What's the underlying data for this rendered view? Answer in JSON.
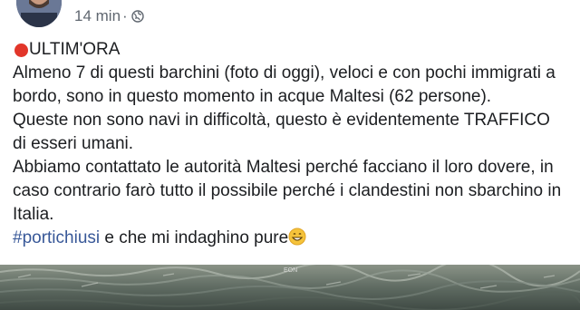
{
  "header": {
    "time": "14 min",
    "separator": "·",
    "privacy_icon": "globe-icon"
  },
  "post": {
    "flag_icon": "red-circle-icon",
    "title": "ULTIM'ORA",
    "lines": [
      "Almeno 7 di questi barchini (foto di oggi), veloci e con pochi immigrati a",
      "bordo, sono in questo momento in acque Maltesi (62 persone).",
      "Queste non sono navi in difficoltà, questo è evidentemente TRAFFICO",
      "di esseri umani.",
      "Abbiamo contattato le autorità Maltesi perché facciano il loro dovere, in",
      "caso contrario farò tutto il possibile perché i clandestini non sbarchino in",
      "Italia."
    ],
    "hashtag": "#portichiusi",
    "last_line": " e che mi indaghino pure",
    "emoji_icon": "grinning-face-icon",
    "photo_label": "EON"
  },
  "colors": {
    "text": "#1c1e21",
    "meta": "#606770",
    "link": "#385898",
    "flag": "#e2362a"
  }
}
